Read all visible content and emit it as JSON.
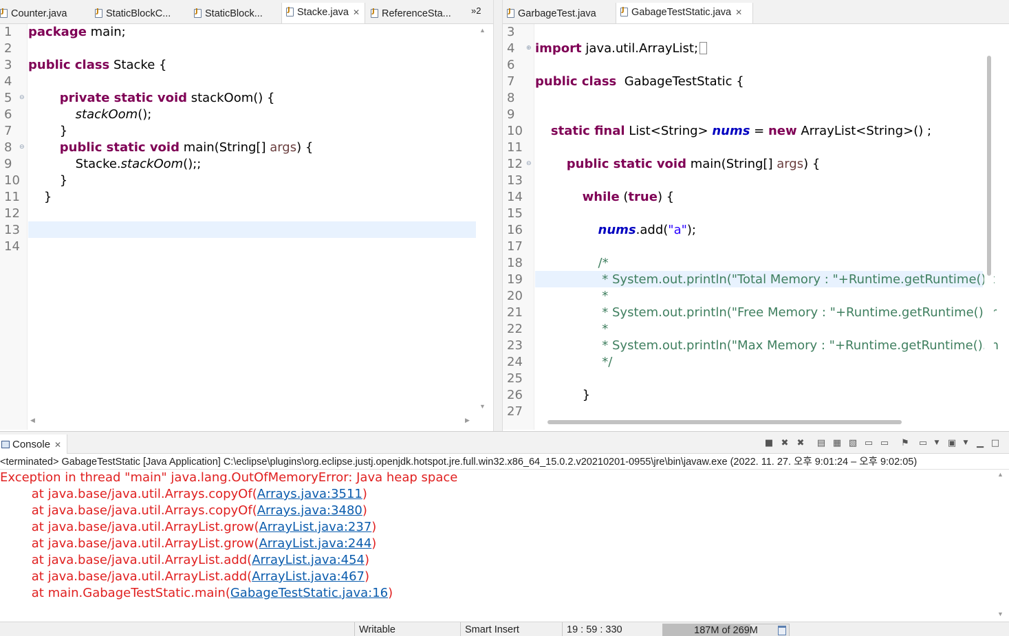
{
  "left_tabs": {
    "items": [
      {
        "label": "Counter.java"
      },
      {
        "label": "StaticBlockC..."
      },
      {
        "label": "StaticBlock..."
      },
      {
        "label": "Stacke.java",
        "active": true
      },
      {
        "label": "ReferenceSta..."
      }
    ],
    "overflow_label": "»2"
  },
  "right_tabs": {
    "items": [
      {
        "label": "GarbageTest.java"
      },
      {
        "label": "GabageTestStatic.java",
        "active": true
      }
    ]
  },
  "left_editor": {
    "line_numbers": [
      "1",
      "2",
      "3",
      "4",
      "5",
      "6",
      "7",
      "8",
      "9",
      "10",
      "11",
      "12",
      "13",
      "14"
    ],
    "lines": [
      [
        {
          "t": "package",
          "c": "kw"
        },
        {
          "t": " main;"
        }
      ],
      [],
      [
        {
          "t": "public class",
          "c": "kw"
        },
        {
          "t": " Stacke {"
        }
      ],
      [],
      [
        {
          "t": "        "
        },
        {
          "t": "private static void",
          "c": "kw"
        },
        {
          "t": " stackOom() {"
        }
      ],
      [
        {
          "t": "            "
        },
        {
          "t": "stackOom",
          "c": "it"
        },
        {
          "t": "();"
        }
      ],
      [
        {
          "t": "        }"
        }
      ],
      [
        {
          "t": "        "
        },
        {
          "t": "public static void",
          "c": "kw"
        },
        {
          "t": " main(String[] "
        },
        {
          "t": "args",
          "c": "param"
        },
        {
          "t": ") {"
        }
      ],
      [
        {
          "t": "            Stacke."
        },
        {
          "t": "stackOom",
          "c": "it"
        },
        {
          "t": "();;"
        }
      ],
      [
        {
          "t": "        }"
        }
      ],
      [
        {
          "t": "    }"
        }
      ],
      [],
      [],
      []
    ],
    "highlight_line": 13
  },
  "right_editor": {
    "line_numbers": [
      "3",
      "4",
      "6",
      "7",
      "8",
      "9",
      "10",
      "11",
      "12",
      "13",
      "14",
      "15",
      "16",
      "17",
      "18",
      "19",
      "20",
      "21",
      "22",
      "23",
      "24",
      "25",
      "26",
      "27"
    ],
    "lines": [
      [],
      [
        {
          "t": "import",
          "c": "kw"
        },
        {
          "t": " java.util.ArrayList;"
        },
        {
          "t": "[]",
          "c": "box"
        }
      ],
      [],
      [
        {
          "t": "public class",
          "c": "kw"
        },
        {
          "t": "  GabageTestStatic {"
        }
      ],
      [],
      [],
      [
        {
          "t": "    "
        },
        {
          "t": "static final",
          "c": "kw"
        },
        {
          "t": " List<String> "
        },
        {
          "t": "nums",
          "c": "fld"
        },
        {
          "t": " = "
        },
        {
          "t": "new",
          "c": "kw"
        },
        {
          "t": " ArrayList<String>() ;"
        }
      ],
      [],
      [
        {
          "t": "        "
        },
        {
          "t": "public static void",
          "c": "kw"
        },
        {
          "t": " main(String[] "
        },
        {
          "t": "args",
          "c": "param"
        },
        {
          "t": ") {"
        }
      ],
      [],
      [
        {
          "t": "            "
        },
        {
          "t": "while",
          "c": "kw"
        },
        {
          "t": " ("
        },
        {
          "t": "true",
          "c": "kw"
        },
        {
          "t": ") {"
        }
      ],
      [],
      [
        {
          "t": "                "
        },
        {
          "t": "nums",
          "c": "fld"
        },
        {
          "t": ".add("
        },
        {
          "t": "\"a\"",
          "c": "str"
        },
        {
          "t": ");"
        }
      ],
      [],
      [
        {
          "t": "                /*",
          "c": "cmt"
        }
      ],
      [
        {
          "t": "                 * System.out.println(\"Total Memory : \"+Runtime.getRuntime().t",
          "c": "cmt"
        }
      ],
      [
        {
          "t": "                 *",
          "c": "cmt"
        }
      ],
      [
        {
          "t": "                 * System.out.println(\"Free Memory : \"+Runtime.getRuntime().fr",
          "c": "cmt"
        }
      ],
      [
        {
          "t": "                 *",
          "c": "cmt"
        }
      ],
      [
        {
          "t": "                 * System.out.println(\"Max Memory : \"+Runtime.getRuntime().m",
          "c": "cmt"
        }
      ],
      [
        {
          "t": "                 */",
          "c": "cmt"
        }
      ],
      [],
      [
        {
          "t": "            }"
        }
      ],
      []
    ],
    "highlight_line": 19
  },
  "console": {
    "tab_label": "Console",
    "description": "<terminated> GabageTestStatic [Java Application] C:\\eclipse\\plugins\\org.eclipse.justj.openjdk.hotspot.jre.full.win32.x86_64_15.0.2.v20210201-0955\\jre\\bin\\javaw.exe  (2022. 11. 27. 오후 9:01:24 – 오후 9:02:05)",
    "lines": [
      {
        "text": "Exception in thread \"main\" java.lang.OutOfMemoryError: Java heap space"
      },
      {
        "text": "        at java.base/java.util.Arrays.copyOf(",
        "link": "Arrays.java:3511",
        "suffix": ")"
      },
      {
        "text": "        at java.base/java.util.Arrays.copyOf(",
        "link": "Arrays.java:3480",
        "suffix": ")"
      },
      {
        "text": "        at java.base/java.util.ArrayList.grow(",
        "link": "ArrayList.java:237",
        "suffix": ")"
      },
      {
        "text": "        at java.base/java.util.ArrayList.grow(",
        "link": "ArrayList.java:244",
        "suffix": ")"
      },
      {
        "text": "        at java.base/java.util.ArrayList.add(",
        "link": "ArrayList.java:454",
        "suffix": ")"
      },
      {
        "text": "        at java.base/java.util.ArrayList.add(",
        "link": "ArrayList.java:467",
        "suffix": ")"
      },
      {
        "text": "        at main.GabageTestStatic.main(",
        "link": "GabageTestStatic.java:16",
        "suffix": ")"
      }
    ]
  },
  "statusbar": {
    "writable": "Writable",
    "insert_mode": "Smart Insert",
    "position": "19 : 59 : 330",
    "heap_label": "187M of 269M",
    "heap_used_fraction": 0.695
  },
  "colors": {
    "keyword": "#7f0055",
    "field": "#0000c0",
    "string": "#2a00ff",
    "comment": "#3f7f5f",
    "error": "#e02020",
    "link": "#0b5cad",
    "current_line": "#e8f2fe"
  }
}
